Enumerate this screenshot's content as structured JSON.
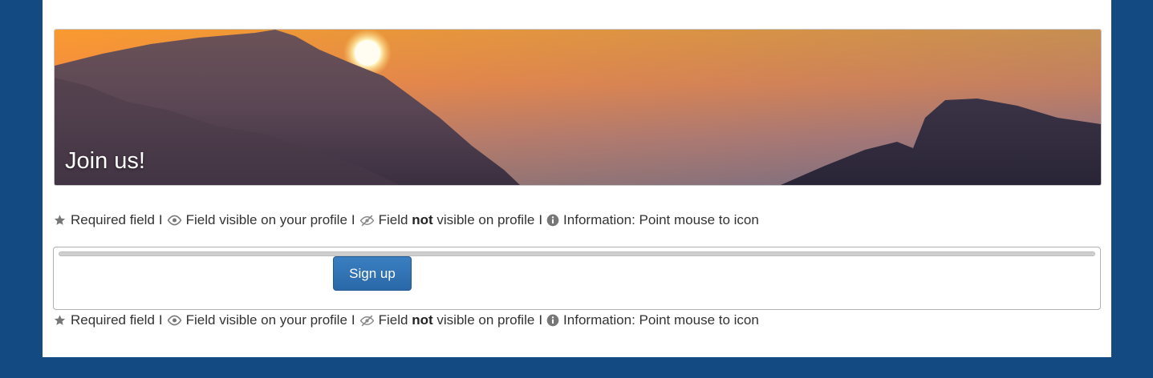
{
  "banner": {
    "title": "Join us!"
  },
  "legend": {
    "required": "Required field",
    "separator": "I",
    "visible": "Field visible on your profile",
    "not_visible_prefix": "Field",
    "not_visible_bold": "not",
    "not_visible_suffix": "visible on profile",
    "information": "Information: Point mouse to icon",
    "icons": [
      "star-icon",
      "eye-icon",
      "eye-slash-icon",
      "info-icon"
    ]
  },
  "form": {
    "signup_label": "Sign up"
  },
  "colors": {
    "page_background": "#134a82",
    "button": "#2f71b3",
    "icon": "#777777"
  }
}
